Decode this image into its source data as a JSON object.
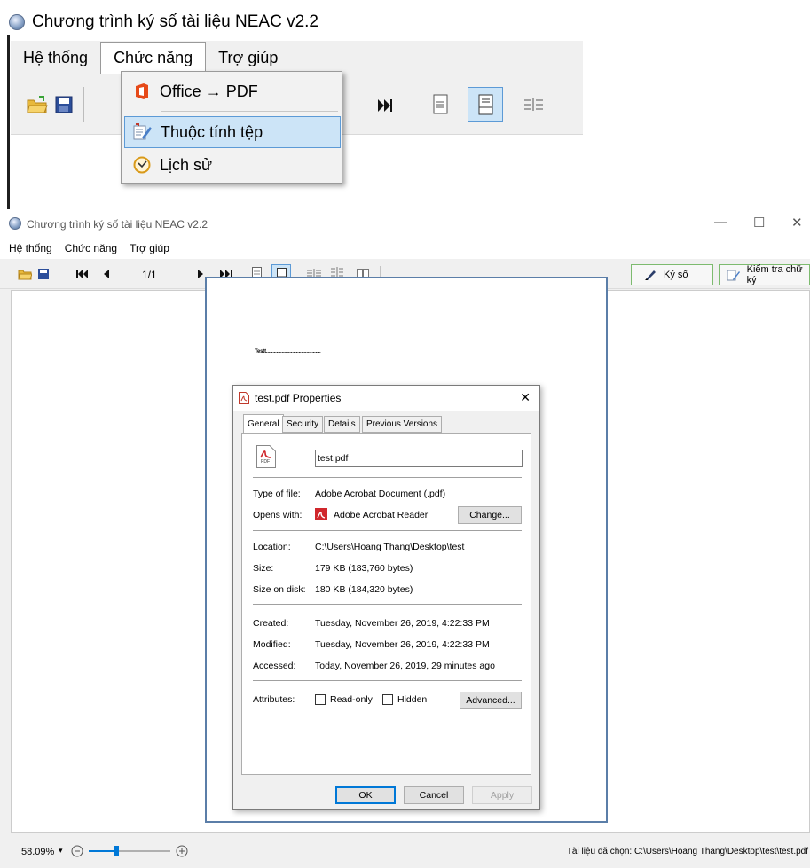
{
  "app": {
    "title": "Chương trình ký số tài liệu NEAC v2.2"
  },
  "menus": {
    "system": "Hệ thống",
    "function": "Chức năng",
    "help": "Trợ giúp"
  },
  "function_menu": {
    "items": [
      {
        "label": "Office → PDF",
        "icon": "office-icon"
      },
      {
        "label": "Thuộc tính tệp",
        "icon": "properties-icon",
        "highlighted": true
      },
      {
        "label": "Lịch sử",
        "icon": "history-clock-icon"
      }
    ]
  },
  "window_controls": {
    "minimize": "—",
    "maximize": "☐",
    "close": "✕"
  },
  "toolbar": {
    "page_indicator": "1/1",
    "sign_label": "Ký số",
    "verify_label": "Kiểm tra chữ ký"
  },
  "document": {
    "text": "Testt.........................................."
  },
  "dialog": {
    "title": "test.pdf Properties",
    "tabs": [
      "General",
      "Security",
      "Details",
      "Previous Versions"
    ],
    "active_tab": "General",
    "filename": "test.pdf",
    "pdf_icon_label": "PDF",
    "fields": {
      "type_label": "Type of file:",
      "type_value": "Adobe Acrobat Document (.pdf)",
      "opens_label": "Opens with:",
      "opens_value": "Adobe Acrobat Reader",
      "change_label": "Change...",
      "location_label": "Location:",
      "location_value": "C:\\Users\\Hoang Thang\\Desktop\\test",
      "size_label": "Size:",
      "size_value": "179 KB (183,760 bytes)",
      "size_disk_label": "Size on disk:",
      "size_disk_value": "180 KB (184,320 bytes)",
      "created_label": "Created:",
      "created_value": "Tuesday, November 26, 2019, 4:22:33 PM",
      "modified_label": "Modified:",
      "modified_value": "Tuesday, November 26, 2019, 4:22:33 PM",
      "accessed_label": "Accessed:",
      "accessed_value": "Today, November 26, 2019, 29 minutes ago",
      "attributes_label": "Attributes:",
      "readonly_label": "Read-only",
      "hidden_label": "Hidden",
      "advanced_label": "Advanced..."
    },
    "buttons": {
      "ok": "OK",
      "cancel": "Cancel",
      "apply": "Apply"
    }
  },
  "status": {
    "zoom": "58.09%",
    "zoom_slider_fraction": 0.34,
    "selected_file": "Tài liệu đã chọn: C:\\Users\\Hoang Thang\\Desktop\\test\\test.pdf"
  },
  "colors": {
    "accent": "#0078d7",
    "highlight": "#cce4f7",
    "sign_border": "#7dbb6f",
    "page_border": "#5b7ea8"
  }
}
